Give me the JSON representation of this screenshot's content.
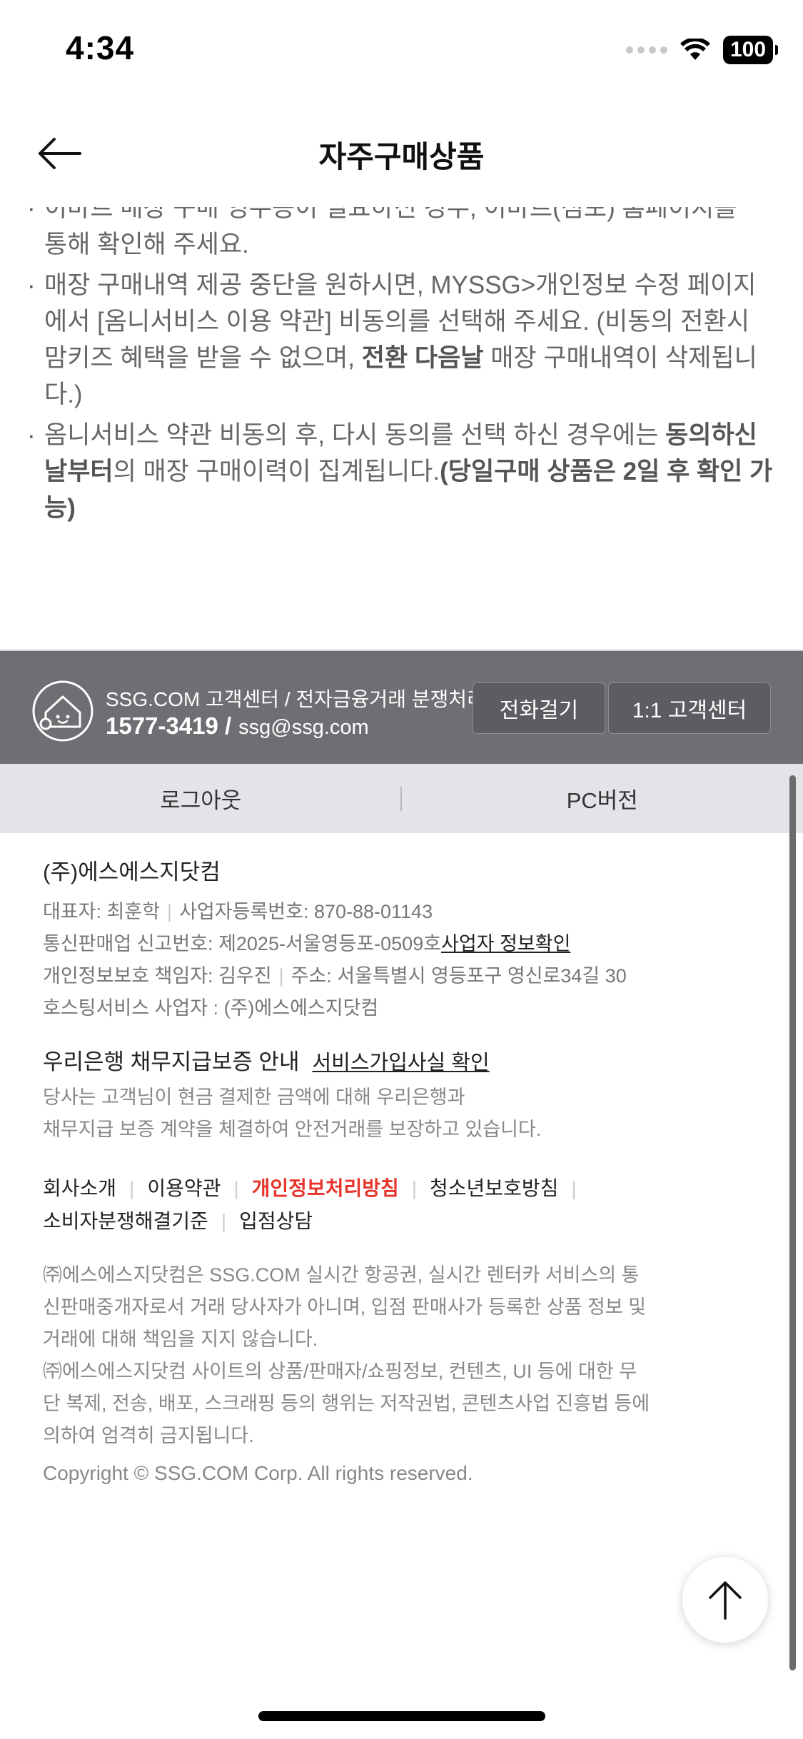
{
  "status_bar": {
    "time": "4:34",
    "battery": "100"
  },
  "header": {
    "title": "자주구매상품"
  },
  "notice": {
    "bullet": "·",
    "item1_cut_line1": "이마트 매장 구매 영수증이 필요하신 경우, 이마트(점포) 홈페이지를",
    "item1_line2": "통해 확인해 주세요.",
    "item2_text": "매장 구매내역 제공 중단을 원하시면, MYSSG>개인정보 수정 페이지에서 [옴니서비스 이용 약관] 비동의를 선택해 주세요. (비동의 전환시 맘키즈 혜택을 받을 수 없으며, ",
    "item2_bold": "전환 다음날",
    "item2_tail": " 매장 구매내역이 삭제됩니다.)",
    "item3_text": "옴니서비스 약관 비동의 후, 다시 동의를 선택 하신 경우에는 ",
    "item3_bold1": "동의하신 날부터",
    "item3_mid": "의 매장 구매이력이 집계됩니다.",
    "item3_bold2": "(당일구매 상품은 2일 후 확인 가능)"
  },
  "cs": {
    "title": "SSG.COM 고객센터 / 전자금융거래 분쟁처리",
    "phone": "1577-3419 /",
    "email": "ssg@ssg.com",
    "call_button": "전화걸기",
    "center_button": "1:1 고객센터"
  },
  "login_bar": {
    "logout": "로그아웃",
    "pc_version": "PC버전"
  },
  "company": {
    "name": "(주)에스에스지닷컴",
    "ceo": "대표자: 최훈학",
    "biz_no": "사업자등록번호: 870-88-01143",
    "mail_order_no": "통신판매업 신고번호: 제2025-서울영등포-0509호",
    "biz_info_link": "사업자 정보확인",
    "privacy_officer": "개인정보보호 책임자: 김우진",
    "address": "주소: 서울특별시 영등포구 영신로34길 30",
    "hosting": "호스팅서비스 사업자 : (주)에스에스지닷컴"
  },
  "guarantee": {
    "title": "우리은행 채무지급보증 안내",
    "link": "서비스가입사실 확인",
    "line1": "당사는 고객님이 현금 결제한 금액에 대해 우리은행과",
    "line2": "채무지급 보증 계약을 체결하여 안전거래를 보장하고 있습니다."
  },
  "policy_links": {
    "company_intro": "회사소개",
    "terms": "이용약관",
    "privacy_policy": "개인정보처리방침",
    "youth_policy": "청소년보호방침",
    "dispute_standard": "소비자분쟁해결기준",
    "partnership": "입점상담",
    "separator": "|"
  },
  "disclaimer": {
    "line1": "㈜에스에스지닷컴은 SSG.COM 실시간 항공권, 실시간 렌터카 서비스의 통",
    "line2": "신판매중개자로서 거래 당사자가 아니며, 입점 판매사가 등록한 상품 정보 및",
    "line3": "거래에 대해 책임을 지지 않습니다.",
    "line4": "㈜에스에스지닷컴 사이트의 상품/판매자/쇼핑정보, 컨텐츠, UI 등에 대한 무",
    "line5": "단 복제, 전송, 배포, 스크래핑 등의 행위는 저작권법, 콘텐츠사업 진흥법 등에",
    "line6": "의하여 엄격히 금지됩니다."
  },
  "copyright": "Copyright © SSG.COM Corp. All rights reserved.",
  "colors": {
    "cs_bar": "#6e6f73",
    "login_bar": "#e3e3e8",
    "privacy_red": "#e7352c"
  }
}
